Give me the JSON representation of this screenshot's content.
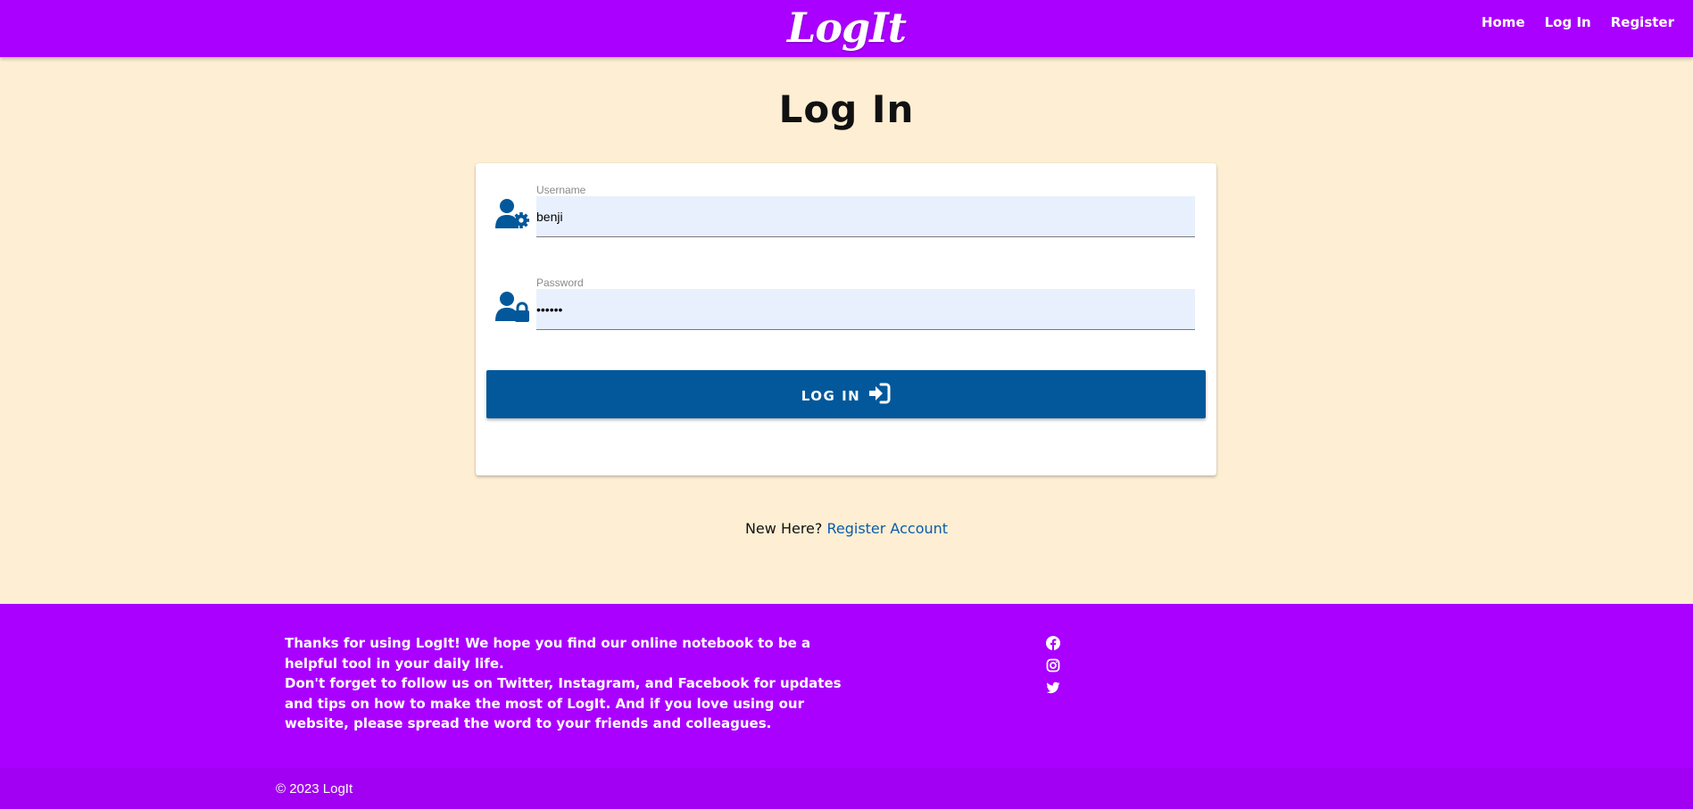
{
  "navbar": {
    "brand": "LogIt",
    "links": [
      {
        "label": "Home"
      },
      {
        "label": "Log In"
      },
      {
        "label": "Register"
      }
    ]
  },
  "main": {
    "title": "Log In",
    "form": {
      "username": {
        "label": "Username",
        "value": "benji",
        "icon": "user-gear-icon"
      },
      "password": {
        "label": "Password",
        "value": "••••••",
        "icon": "user-lock-icon"
      },
      "submit": {
        "label": "LOG IN",
        "icon": "sign-in-icon"
      }
    },
    "register_prompt": "New Here?",
    "register_link": "Register Account"
  },
  "footer": {
    "text_line1": "Thanks for using LogIt! We hope you find our online notebook to be a helpful tool in your daily life.",
    "text_line2": "Don't forget to follow us on Twitter, Instagram, and Facebook for updates and tips on how to make the most of LogIt. And if you love using our website, please spread the word to your friends and colleagues.",
    "social": [
      "facebook-icon",
      "instagram-icon",
      "twitter-icon"
    ],
    "copyright": "© 2023 LogIt"
  },
  "colors": {
    "nav_bg": "#aa00ff",
    "page_bg": "#feeed3",
    "button_bg": "#02589b",
    "icon_blue": "#02589b",
    "link_blue": "#0a5cab"
  }
}
